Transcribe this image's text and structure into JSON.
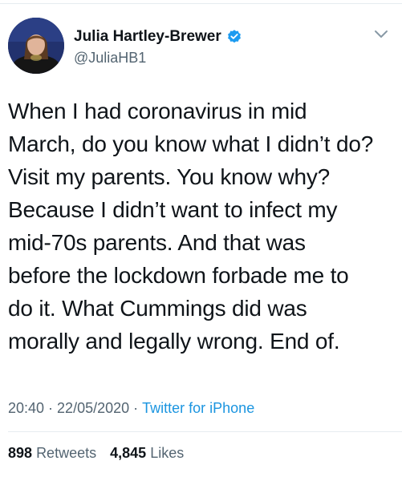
{
  "author": {
    "display_name": "Julia Hartley-Brewer",
    "handle": "@JuliaHB1",
    "verified": true,
    "avatar_icon": "profile-photo"
  },
  "tweet": {
    "lines": [
      "When I had coronavirus in mid",
      "March, do you know what I didn’t do?",
      "Visit my parents. You know why?",
      "Because I didn’t want to infect my",
      "mid-70s parents. And that was",
      "before the lockdown forbade me to",
      "do it. What Cummings did was",
      "morally and legally wrong. End of."
    ]
  },
  "meta": {
    "time": "20:40",
    "separator": "·",
    "date": "22/05/2020",
    "source": "Twitter for iPhone"
  },
  "stats": {
    "retweets_count": "898",
    "retweets_label": "Retweets",
    "likes_count": "4,845",
    "likes_label": "Likes"
  },
  "colors": {
    "text": "#0f1419",
    "secondary": "#536471",
    "link": "#1b95e0",
    "verified": "#1d9bf0",
    "divider": "#e6ecf0"
  }
}
